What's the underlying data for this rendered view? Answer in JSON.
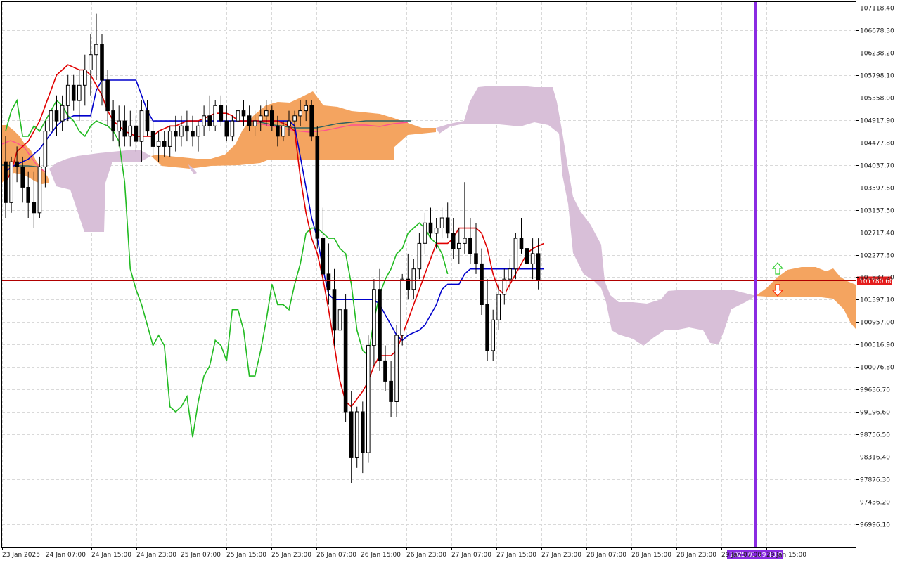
{
  "chart_data": {
    "type": "candlestick",
    "symbol": "",
    "y_ticks": [
      96996.1,
      97436.2,
      97876.3,
      98316.4,
      98756.5,
      99196.6,
      99636.7,
      100076.8,
      100516.9,
      100957.0,
      101397.1,
      101837.2,
      102277.3,
      102717.4,
      103157.5,
      103597.6,
      104037.7,
      104477.8,
      104917.9,
      105358.0,
      105798.1,
      106238.2,
      106678.3,
      107118.4
    ],
    "y_tick_labels": [
      "96996.10",
      "97436.20",
      "97876.30",
      "98316.40",
      "98756.50",
      "99196.60",
      "99636.70",
      "100076.80",
      "100516.90",
      "100957.00",
      "101397.10",
      "101837.20",
      "102277.30",
      "102717.40",
      "103157.50",
      "103597.60",
      "104037.70",
      "104477.80",
      "104917.90",
      "105358.00",
      "105798.10",
      "106238.20",
      "106678.30",
      "107118.40"
    ],
    "x_tick_labels": [
      "23 Jan 2025",
      "24 Jan 07:00",
      "24 Jan 15:00",
      "24 Jan 23:00",
      "25 Jan 07:00",
      "25 Jan 15:00",
      "25 Jan 23:00",
      "26 Jan 07:00",
      "26 Jan 15:00",
      "26 Jan 23:00",
      "27 Jan 07:00",
      "27 Jan 15:00",
      "27 Jan 23:00",
      "28 Jan 07:00",
      "28 Jan 15:00",
      "28 Jan 23:00",
      "29 Jan 07:00",
      "29 Jan 15:00"
    ],
    "current_price": 101780.6,
    "current_price_label": "101780.60",
    "cursor_time_label": "2025.01.29 13:00",
    "colors": {
      "tenkan": "#e00000",
      "kijun": "#0000cc",
      "chikou": "#22bb22",
      "senkou_a": "#ff5090",
      "senkou_b": "#2a6060",
      "cloud_bull": "#f4a460",
      "cloud_bear": "#d8bfd8",
      "cursor": "#8a2be2",
      "price_line": "#b00000",
      "arrow_up": "#32cd32",
      "arrow_down": "#ff2a00"
    },
    "candles": [
      [
        104100,
        104600,
        103000,
        103300
      ],
      [
        103300,
        104200,
        103100,
        104100
      ],
      [
        104100,
        104400,
        103700,
        104000
      ],
      [
        104000,
        104200,
        103300,
        103600
      ],
      [
        103600,
        103900,
        103000,
        103300
      ],
      [
        103300,
        103900,
        102800,
        103100
      ],
      [
        103100,
        104200,
        103000,
        104000
      ],
      [
        104000,
        104900,
        103600,
        104700
      ],
      [
        104700,
        105300,
        104400,
        105100
      ],
      [
        105100,
        105400,
        104600,
        104900
      ],
      [
        104900,
        105400,
        104700,
        105200
      ],
      [
        105200,
        105800,
        104900,
        105600
      ],
      [
        105600,
        105800,
        105100,
        105300
      ],
      [
        105300,
        105900,
        104900,
        105600
      ],
      [
        105600,
        106200,
        105200,
        105900
      ],
      [
        105900,
        106600,
        105400,
        106200
      ],
      [
        106200,
        107000,
        105700,
        106400
      ],
      [
        106400,
        106600,
        105200,
        105700
      ],
      [
        105700,
        105900,
        104800,
        105100
      ],
      [
        105100,
        105300,
        104500,
        104700
      ],
      [
        104700,
        105200,
        104400,
        104900
      ],
      [
        104900,
        105200,
        104400,
        104600
      ],
      [
        104600,
        105100,
        104400,
        104800
      ],
      [
        104800,
        105000,
        104300,
        104500
      ],
      [
        104500,
        105300,
        104100,
        105100
      ],
      [
        105100,
        105300,
        104600,
        104700
      ],
      [
        104700,
        104900,
        104200,
        104400
      ],
      [
        104400,
        104700,
        104100,
        104500
      ],
      [
        104500,
        104700,
        104200,
        104400
      ],
      [
        104400,
        104800,
        104200,
        104700
      ],
      [
        104700,
        105000,
        104300,
        104600
      ],
      [
        104600,
        105000,
        104400,
        104800
      ],
      [
        104800,
        105100,
        104500,
        104700
      ],
      [
        104700,
        105000,
        104400,
        104600
      ],
      [
        104600,
        104900,
        104300,
        104800
      ],
      [
        104800,
        105200,
        104600,
        105000
      ],
      [
        105000,
        105400,
        104700,
        104800
      ],
      [
        104800,
        105300,
        104700,
        105200
      ],
      [
        105200,
        105400,
        104800,
        104900
      ],
      [
        104900,
        105200,
        104500,
        104600
      ],
      [
        104600,
        105000,
        104500,
        104900
      ],
      [
        104900,
        105200,
        104600,
        105100
      ],
      [
        105100,
        105300,
        104800,
        105000
      ],
      [
        105000,
        105200,
        104700,
        104800
      ],
      [
        104800,
        105100,
        104600,
        104900
      ],
      [
        104900,
        105200,
        104700,
        105000
      ],
      [
        105000,
        105300,
        104800,
        105100
      ],
      [
        105100,
        105200,
        104700,
        104800
      ],
      [
        104800,
        105000,
        104400,
        104600
      ],
      [
        104600,
        104900,
        104500,
        104800
      ],
      [
        104800,
        105100,
        104600,
        104900
      ],
      [
        104900,
        105100,
        104700,
        105000
      ],
      [
        105000,
        105300,
        104800,
        105100
      ],
      [
        105100,
        105300,
        104900,
        105200
      ],
      [
        105200,
        105300,
        104500,
        104600
      ],
      [
        104600,
        104800,
        102400,
        102600
      ],
      [
        102600,
        103200,
        101700,
        101900
      ],
      [
        101900,
        102500,
        101300,
        101600
      ],
      [
        101600,
        102000,
        100500,
        100800
      ],
      [
        100800,
        101600,
        100300,
        101200
      ],
      [
        101200,
        101500,
        99000,
        99200
      ],
      [
        99200,
        99600,
        97800,
        98300
      ],
      [
        98300,
        99300,
        98100,
        99200
      ],
      [
        99200,
        99400,
        98000,
        98400
      ],
      [
        98400,
        100700,
        98200,
        100500
      ],
      [
        100500,
        101800,
        100100,
        101600
      ],
      [
        101600,
        102000,
        100000,
        100200
      ],
      [
        100200,
        100500,
        99600,
        99800
      ],
      [
        99800,
        100200,
        99100,
        99400
      ],
      [
        99400,
        100900,
        99100,
        100700
      ],
      [
        100700,
        101900,
        100500,
        101800
      ],
      [
        101800,
        102300,
        101400,
        101600
      ],
      [
        101600,
        102200,
        101400,
        102000
      ],
      [
        102000,
        102700,
        101800,
        102500
      ],
      [
        102500,
        103100,
        102300,
        102900
      ],
      [
        102900,
        103200,
        102600,
        102700
      ],
      [
        102700,
        103000,
        102400,
        102800
      ],
      [
        102800,
        103200,
        102600,
        103000
      ],
      [
        103000,
        103300,
        102600,
        102700
      ],
      [
        102700,
        103000,
        102200,
        102400
      ],
      [
        102400,
        102800,
        102100,
        102500
      ],
      [
        102500,
        103700,
        102300,
        102600
      ],
      [
        102600,
        103000,
        102100,
        102300
      ],
      [
        102300,
        102900,
        101900,
        102100
      ],
      [
        102100,
        102400,
        101100,
        101300
      ],
      [
        101300,
        101800,
        100200,
        100400
      ],
      [
        100400,
        101200,
        100200,
        101000
      ],
      [
        101000,
        101700,
        100800,
        101500
      ],
      [
        101500,
        102000,
        101300,
        101800
      ],
      [
        101800,
        102200,
        101600,
        102000
      ],
      [
        102000,
        102700,
        101800,
        102600
      ],
      [
        102600,
        103000,
        102300,
        102400
      ],
      [
        102400,
        102800,
        101900,
        102100
      ],
      [
        102100,
        102600,
        101800,
        102300
      ],
      [
        102300,
        102600,
        101600,
        101780
      ]
    ],
    "tenkan": [
      103700,
      103900,
      104300,
      104400,
      104500,
      104700,
      104900,
      105200,
      105500,
      105800,
      105900,
      106000,
      105950,
      105900,
      105900,
      105800,
      105600,
      105400,
      105100,
      104900,
      104800,
      104700,
      104650,
      104600,
      104600,
      104600,
      104600,
      104700,
      104750,
      104800,
      104800,
      104850,
      104900,
      104900,
      104900,
      104950,
      105000,
      105050,
      105050,
      105050,
      105000,
      104900,
      104900,
      104900,
      104900,
      104900,
      104900,
      104900,
      104900,
      104850,
      104800,
      104700,
      103800,
      103100,
      102600,
      102300,
      101800,
      101200,
      100500,
      99800,
      99400,
      99300,
      99450,
      99600,
      99800,
      100100,
      100300,
      100300,
      100300,
      100400,
      100700,
      101000,
      101300,
      101600,
      101900,
      102200,
      102500,
      102500,
      102500,
      102600,
      102800,
      102800,
      102800,
      102800,
      102700,
      102400,
      101900,
      101600,
      101500,
      101700,
      101900,
      102100,
      102300,
      102400,
      102450,
      102500
    ],
    "kijun": [
      103900,
      104000,
      104050,
      104100,
      104150,
      104250,
      104350,
      104500,
      104650,
      104800,
      104900,
      104950,
      105000,
      105000,
      105000,
      105000,
      105500,
      105700,
      105700,
      105700,
      105700,
      105700,
      105700,
      105700,
      105400,
      105100,
      104900,
      104900,
      104900,
      104900,
      104900,
      104900,
      104900,
      104900,
      104900,
      104900,
      104900,
      104900,
      104900,
      104900,
      104900,
      104900,
      104900,
      104900,
      104900,
      104900,
      104900,
      104900,
      104900,
      104900,
      104900,
      104800,
      104200,
      103600,
      103000,
      102600,
      102000,
      101500,
      101400,
      101400,
      101400,
      101400,
      101400,
      101400,
      101400,
      101400,
      101300,
      101100,
      100900,
      100700,
      100600,
      100700,
      100750,
      100800,
      100900,
      101100,
      101300,
      101600,
      101700,
      101700,
      101700,
      101900,
      102000,
      102000,
      102000,
      102000,
      102000,
      102000,
      102000,
      102000,
      102000,
      102000,
      102000,
      102000,
      102000,
      102000
    ],
    "chikou": [
      104700,
      105100,
      105300,
      104600,
      104600,
      104800,
      104700,
      104900,
      105100,
      105300,
      105200,
      105000,
      104900,
      104700,
      104600,
      104800,
      104900,
      104850,
      104800,
      104700,
      104500,
      103700,
      102000,
      101600,
      101300,
      100900,
      100500,
      100700,
      100500,
      99300,
      99200,
      99300,
      99500,
      98700,
      99400,
      99900,
      100100,
      100600,
      100500,
      100200,
      101200,
      101200,
      100800,
      99900,
      99900,
      100400,
      101000,
      101700,
      101300,
      101300,
      101200,
      101700,
      102100,
      102700,
      102800,
      102800,
      102700,
      102600,
      102600,
      102400,
      102300,
      101700,
      100800,
      100400,
      100300,
      101000,
      101500,
      101800,
      102000,
      102300,
      102400,
      102700,
      102800,
      102900,
      102800,
      102600,
      102500,
      102300,
      101900
    ]
  }
}
